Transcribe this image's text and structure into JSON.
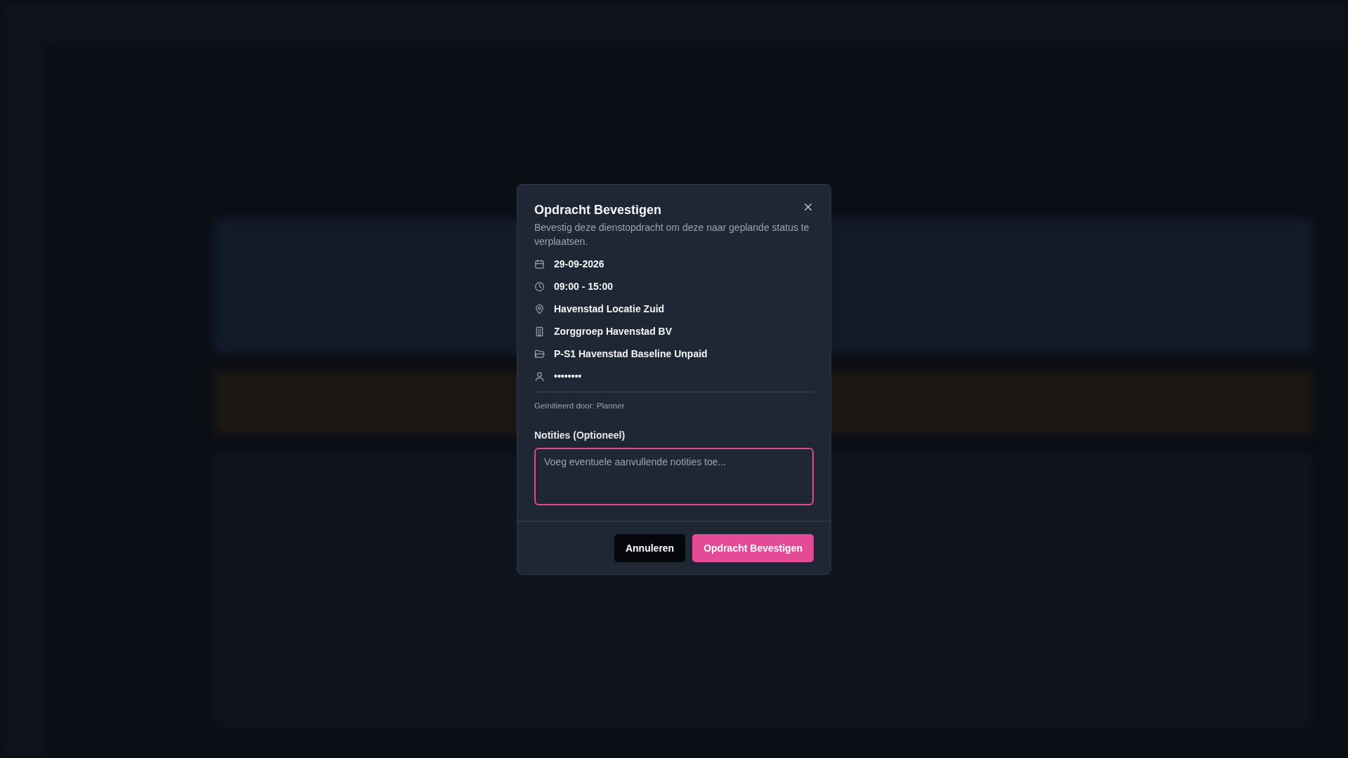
{
  "dialog": {
    "title": "Opdracht Bevestigen",
    "description": "Bevestig deze dienstopdracht om deze naar geplande status te verplaatsen.",
    "details": [
      {
        "kind": "date",
        "text": "29-09-2026"
      },
      {
        "kind": "time",
        "text": "09:00 - 15:00"
      },
      {
        "kind": "location",
        "text": "Havenstad Locatie Zuid"
      },
      {
        "kind": "company",
        "text": "Zorggroep Havenstad BV"
      },
      {
        "kind": "project",
        "text": "P-S1 Havenstad Baseline Unpaid"
      },
      {
        "kind": "person",
        "text": "••••••••"
      }
    ],
    "initiated_by": "Geïnitieerd door: Planner",
    "notes": {
      "label": "Notities (Optioneel)",
      "placeholder": "Voeg eventuele aanvullende notities toe..."
    },
    "buttons": [
      {
        "kind": "secondary",
        "label": "Annuleren"
      },
      {
        "kind": "primary",
        "label": "Opdracht Bevestigen"
      }
    ]
  }
}
